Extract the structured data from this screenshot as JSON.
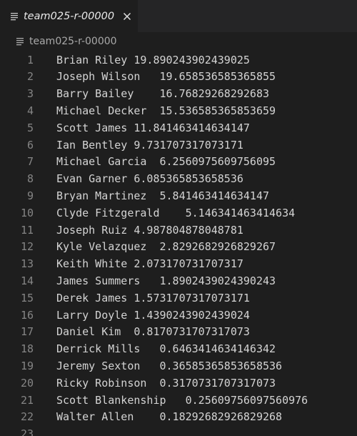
{
  "tab": {
    "label": "team025-r-00000",
    "file_icon": "lines-file-icon",
    "close_icon": "close-icon"
  },
  "breadcrumb": {
    "label": "team025-r-00000",
    "file_icon": "lines-file-icon"
  },
  "editor": {
    "lines": [
      {
        "number": "1",
        "text": "Brian Riley 19.890243902439025"
      },
      {
        "number": "2",
        "text": "Joseph Wilson\t19.658536585365855"
      },
      {
        "number": "3",
        "text": "Barry Bailey\t16.76829268292683"
      },
      {
        "number": "4",
        "text": "Michael Decker\t15.536585365853659"
      },
      {
        "number": "5",
        "text": "Scott James 11.841463414634147"
      },
      {
        "number": "6",
        "text": "Ian Bentley 9.731707317073171"
      },
      {
        "number": "7",
        "text": "Michael Garcia\t6.2560975609756095"
      },
      {
        "number": "8",
        "text": "Evan Garner 6.085365853658536"
      },
      {
        "number": "9",
        "text": "Bryan Martinez\t5.841463414634147"
      },
      {
        "number": "10",
        "text": "Clyde Fitzgerald\t5.146341463414634"
      },
      {
        "number": "11",
        "text": "Joseph Ruiz 4.987804878048781"
      },
      {
        "number": "12",
        "text": "Kyle Velazquez\t2.8292682926829267"
      },
      {
        "number": "13",
        "text": "Keith White 2.073170731707317"
      },
      {
        "number": "14",
        "text": "James Summers\t1.8902439024390243"
      },
      {
        "number": "15",
        "text": "Derek James 1.5731707317073171"
      },
      {
        "number": "16",
        "text": "Larry Doyle 1.4390243902439024"
      },
      {
        "number": "17",
        "text": "Daniel Kim\t0.8170731707317073"
      },
      {
        "number": "18",
        "text": "Derrick Mills\t0.6463414634146342"
      },
      {
        "number": "19",
        "text": "Jeremy Sexton\t0.36585365853658536"
      },
      {
        "number": "20",
        "text": "Ricky Robinson\t0.3170731707317073"
      },
      {
        "number": "21",
        "text": "Scott Blankenship\t0.25609756097560976"
      },
      {
        "number": "22",
        "text": "Walter Allen\t0.18292682926829268"
      },
      {
        "number": "23",
        "text": ""
      }
    ]
  },
  "colors": {
    "editor_background": "#1e1e1e",
    "tabbar_background": "#252526",
    "text": "#d4d4d4",
    "line_number": "#858585",
    "breadcrumb_text": "#a9a9a9"
  }
}
